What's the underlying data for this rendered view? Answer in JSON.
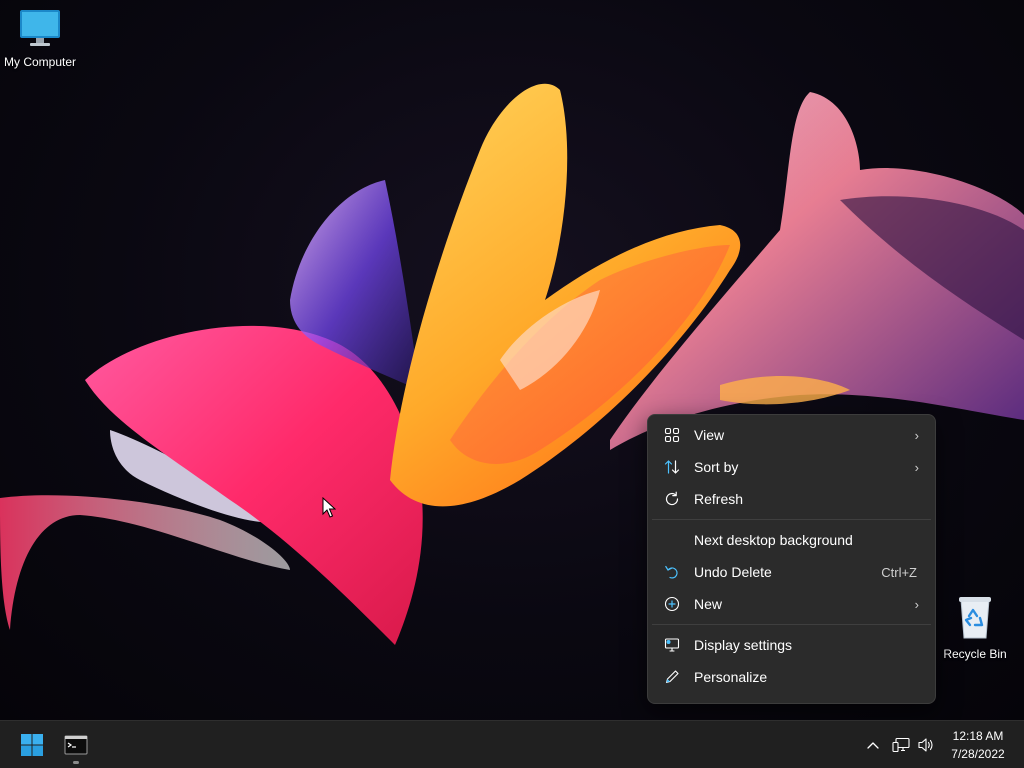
{
  "desktop": {
    "icons": [
      {
        "label": "My Computer",
        "icon": "monitor-icon"
      },
      {
        "label": "Recycle Bin",
        "icon": "recycle-bin-icon"
      }
    ]
  },
  "context_menu": {
    "items": [
      {
        "label": "View",
        "icon": "view-grid-icon",
        "submenu": true
      },
      {
        "label": "Sort by",
        "icon": "sort-icon",
        "submenu": true
      },
      {
        "label": "Refresh",
        "icon": "refresh-icon"
      },
      {
        "label": "Next desktop background",
        "icon": ""
      },
      {
        "label": "Undo Delete",
        "icon": "undo-icon",
        "shortcut": "Ctrl+Z"
      },
      {
        "label": "New",
        "icon": "add-circle-icon",
        "submenu": true
      },
      {
        "label": "Display settings",
        "icon": "display-settings-icon"
      },
      {
        "label": "Personalize",
        "icon": "pen-icon"
      }
    ],
    "arrow": "›"
  },
  "taskbar": {
    "apps": [
      {
        "icon": "windows-start-icon"
      },
      {
        "icon": "terminal-icon"
      }
    ],
    "tray": {
      "icons": [
        "chevron-up-icon",
        "network-icon",
        "volume-icon"
      ]
    },
    "clock": {
      "time": "12:18 AM",
      "date": "7/28/2022"
    }
  },
  "colors": {
    "accent": "#4cc2ff",
    "menu_bg": "#2b2b2b",
    "taskbar_bg": "#202020"
  }
}
